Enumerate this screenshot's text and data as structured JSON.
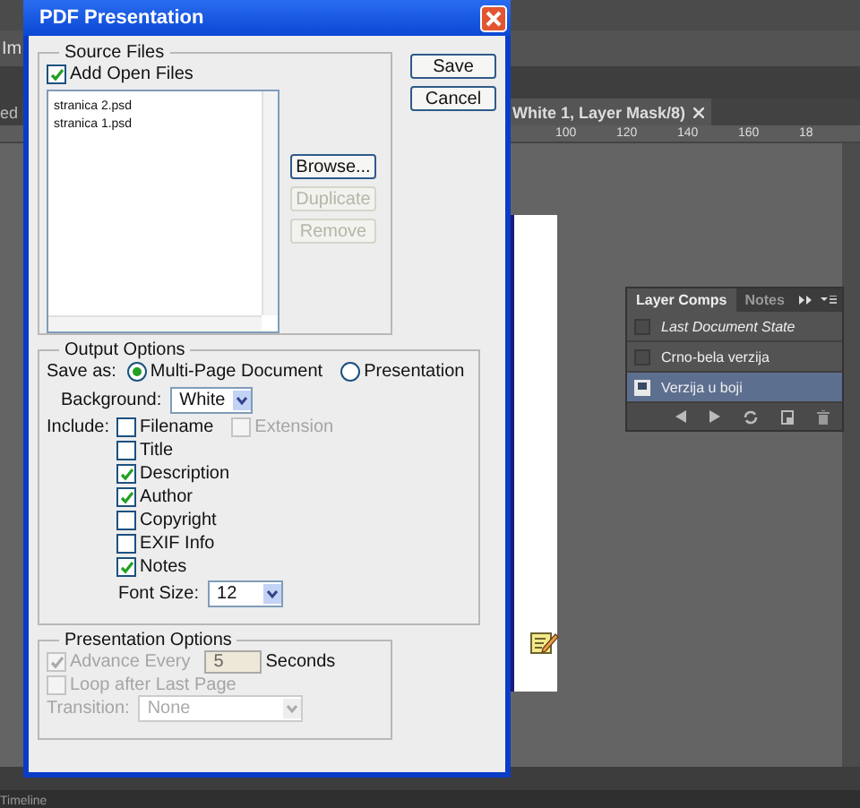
{
  "app": {
    "menu_fragment": "Im",
    "tabs": [
      {
        "label": "ed",
        "selected": false
      },
      {
        "label": "White 1, Layer Mask/8)",
        "selected": true
      }
    ],
    "ruler_labels": [
      "100",
      "120",
      "140",
      "160",
      "18"
    ],
    "timeline_label": "Timeline"
  },
  "layer_comps": {
    "tabs": [
      {
        "label": "Layer Comps",
        "selected": true
      },
      {
        "label": "Notes",
        "selected": false
      }
    ],
    "comps": [
      {
        "name": "Last Document State",
        "kind": "last_state",
        "applied": false,
        "selected": false
      },
      {
        "name": "Crno-bela verzija",
        "kind": "comp",
        "applied": false,
        "selected": false
      },
      {
        "name": "Verzija u boji",
        "kind": "comp",
        "applied": true,
        "selected": true
      }
    ]
  },
  "dialog": {
    "title": "PDF Presentation",
    "source_files": {
      "legend": "Source Files",
      "add_open_files": {
        "label": "Add Open Files",
        "checked": true
      },
      "files": [
        "stranica 2.psd",
        "stranica 1.psd"
      ],
      "buttons": [
        {
          "label": "Browse...",
          "disabled": false
        },
        {
          "label": "Duplicate",
          "disabled": true
        },
        {
          "label": "Remove",
          "disabled": true
        }
      ]
    },
    "actions": [
      {
        "label": "Save"
      },
      {
        "label": "Cancel"
      }
    ],
    "output_options": {
      "legend": "Output Options",
      "save_as": {
        "label": "Save as:",
        "options": [
          {
            "label": "Multi-Page Document",
            "selected": true
          },
          {
            "label": "Presentation",
            "selected": false
          }
        ]
      },
      "background": {
        "label": "Background:",
        "value": "White"
      },
      "include": {
        "label": "Include:",
        "rows": [
          [
            {
              "label": "Filename",
              "checked": false,
              "disabled": false
            },
            {
              "label": "Extension",
              "checked": false,
              "disabled": true
            }
          ],
          [
            {
              "label": "Title",
              "checked": false,
              "disabled": false
            }
          ],
          [
            {
              "label": "Description",
              "checked": true,
              "disabled": false
            }
          ],
          [
            {
              "label": "Author",
              "checked": true,
              "disabled": false
            }
          ],
          [
            {
              "label": "Copyright",
              "checked": false,
              "disabled": false
            }
          ],
          [
            {
              "label": "EXIF Info",
              "checked": false,
              "disabled": false
            }
          ],
          [
            {
              "label": "Notes",
              "checked": true,
              "disabled": false
            }
          ]
        ]
      },
      "font_size": {
        "label": "Font Size:",
        "value": "12"
      }
    },
    "presentation_options": {
      "legend": "Presentation Options",
      "advance": {
        "label": "Advance Every",
        "checked": true,
        "disabled": true,
        "value": "5",
        "unit": "Seconds"
      },
      "loop": {
        "label": "Loop after Last Page",
        "checked": false,
        "disabled": true
      },
      "transition": {
        "label": "Transition:",
        "value": "None",
        "disabled": true
      }
    }
  }
}
